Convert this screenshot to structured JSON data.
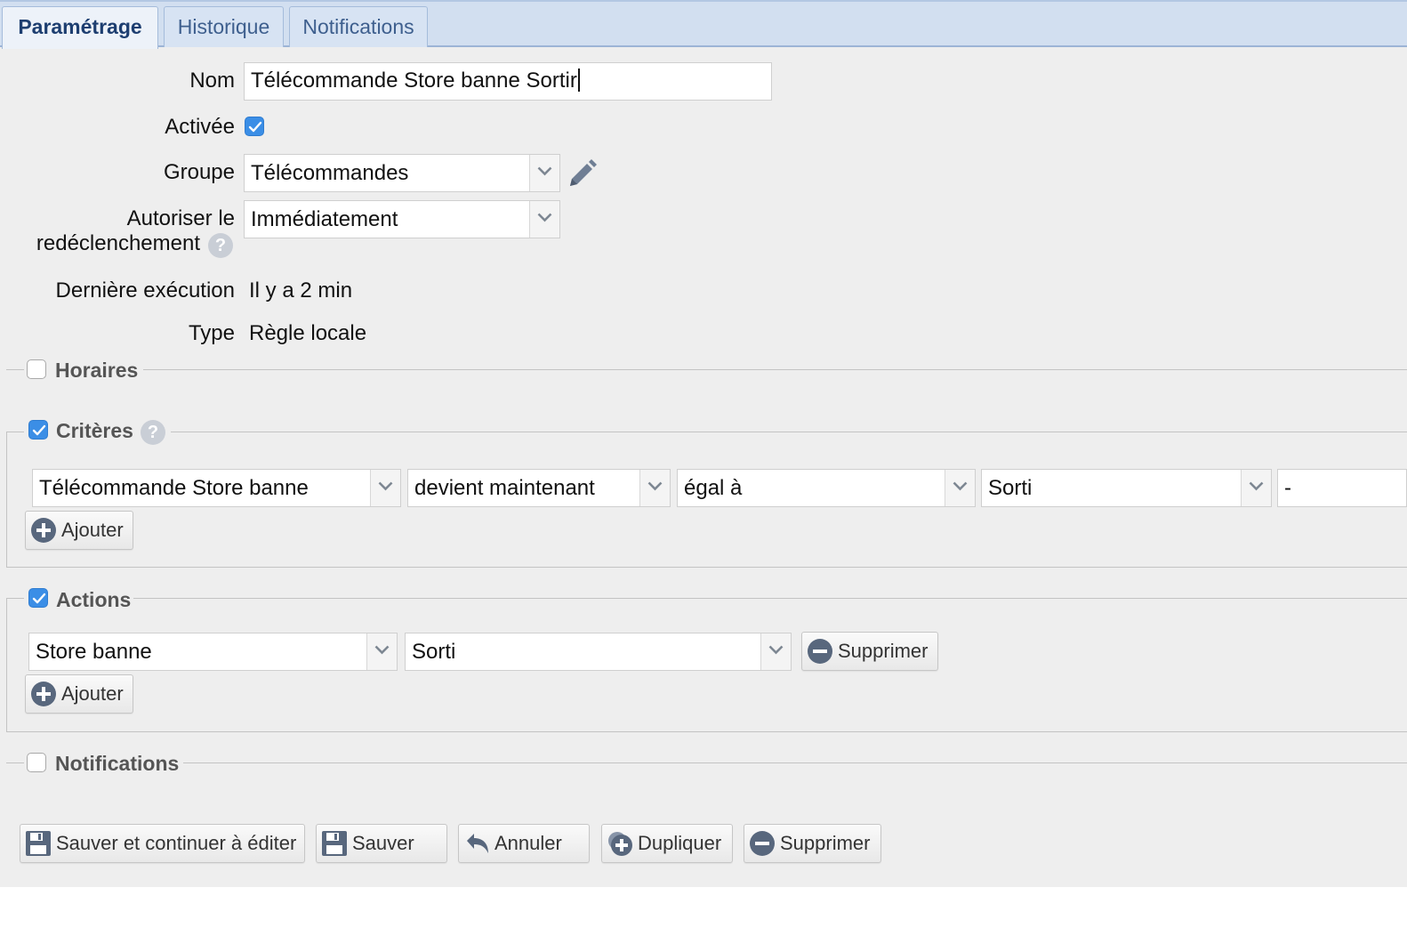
{
  "tabs": [
    {
      "label": "Paramétrage",
      "active": true
    },
    {
      "label": "Historique",
      "active": false
    },
    {
      "label": "Notifications",
      "active": false
    }
  ],
  "form": {
    "nom_label": "Nom",
    "nom_value": "Télécommande Store banne Sortir",
    "activee_label": "Activée",
    "activee_checked": true,
    "groupe_label": "Groupe",
    "groupe_value": "Télécommandes",
    "autoriser_label_line1": "Autoriser le",
    "autoriser_label_line2": "redéclenchement",
    "autoriser_value": "Immédiatement",
    "derniere_label": "Dernière exécution",
    "derniere_value": "Il y a 2 min",
    "type_label": "Type",
    "type_value": "Règle locale"
  },
  "sections": {
    "horaires": {
      "title": "Horaires",
      "checked": false
    },
    "criteres": {
      "title": "Critères",
      "checked": true,
      "device": "Télécommande Store banne",
      "event": "devient maintenant",
      "operator": "égal à",
      "value": "Sorti",
      "extra": "-",
      "add_label": "Ajouter"
    },
    "actions": {
      "title": "Actions",
      "checked": true,
      "device": "Store banne",
      "value": "Sorti",
      "delete_label": "Supprimer",
      "add_label": "Ajouter"
    },
    "notifications": {
      "title": "Notifications",
      "checked": false
    }
  },
  "footer": {
    "save_continue": "Sauver et continuer à éditer",
    "save": "Sauver",
    "cancel": "Annuler",
    "duplicate": "Dupliquer",
    "delete": "Supprimer"
  },
  "colors": {
    "accent": "#3b8ee6",
    "tab_bar": "#d2dff0",
    "panel": "#eeeeee"
  }
}
